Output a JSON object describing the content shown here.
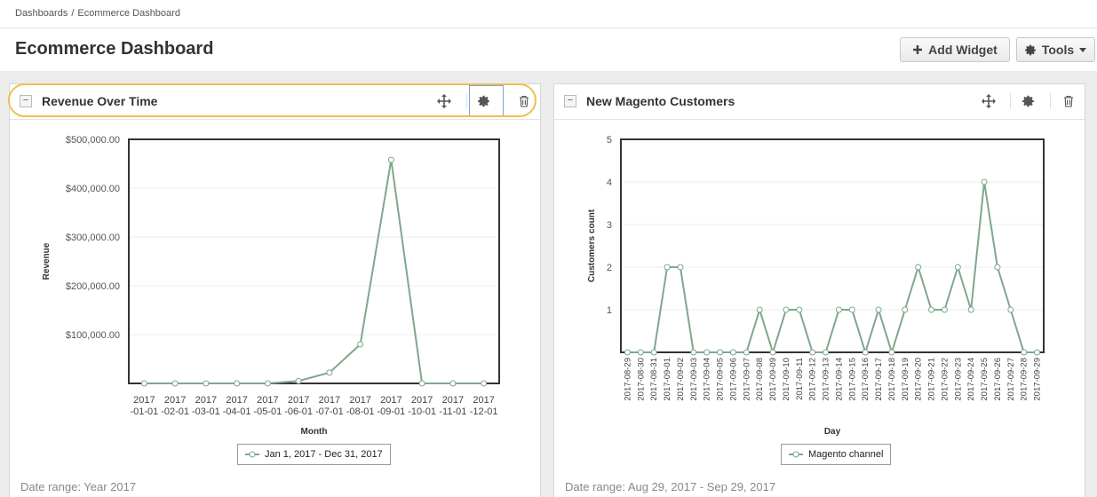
{
  "breadcrumb": {
    "root": "Dashboards",
    "separator": "/",
    "current": "Ecommerce Dashboard"
  },
  "page": {
    "title": "Ecommerce Dashboard"
  },
  "toolbar": {
    "add_widget_label": "Add Widget",
    "tools_label": "Tools"
  },
  "colors": {
    "series": "#7ea88c",
    "highlight": "#f0c050",
    "active_icon_border": "#7aa6d8"
  },
  "widgets": [
    {
      "title": "Revenue Over Time",
      "collapse_label": "−",
      "icons": [
        "move-icon",
        "gear-icon",
        "trash-icon"
      ],
      "footer": "Date range: Year 2017",
      "legend": "Jan 1, 2017 - Dec 31, 2017"
    },
    {
      "title": "New Magento Customers",
      "collapse_label": "−",
      "icons": [
        "move-icon",
        "gear-icon",
        "trash-icon"
      ],
      "footer": "Date range: Aug 29, 2017 - Sep 29, 2017",
      "legend": "Magento channel"
    }
  ],
  "chart_data": [
    {
      "type": "line",
      "xlabel": "Month",
      "ylabel": "Revenue",
      "categories": [
        "2017-01-01",
        "2017-02-01",
        "2017-03-01",
        "2017-04-01",
        "2017-05-01",
        "2017-06-01",
        "2017-07-01",
        "2017-08-01",
        "2017-09-01",
        "2017-10-01",
        "2017-11-01",
        "2017-12-01"
      ],
      "series": [
        {
          "name": "Jan 1, 2017 - Dec 31, 2017",
          "values": [
            0,
            0,
            0,
            0,
            0,
            5000,
            22000,
            80000,
            458000,
            0,
            0,
            0
          ]
        }
      ],
      "ylim": [
        0,
        500000
      ],
      "yticks": [
        100000,
        200000,
        300000,
        400000,
        500000
      ],
      "ytick_labels": [
        "$100,000.00",
        "$200,000.00",
        "$300,000.00",
        "$400,000.00",
        "$500,000.00"
      ],
      "grid": true,
      "legend_position": "bottom"
    },
    {
      "type": "line",
      "xlabel": "Day",
      "ylabel": "Customers count",
      "categories": [
        "2017-08-29",
        "2017-08-30",
        "2017-08-31",
        "2017-09-01",
        "2017-09-02",
        "2017-09-03",
        "2017-09-04",
        "2017-09-05",
        "2017-09-06",
        "2017-09-07",
        "2017-09-08",
        "2017-09-09",
        "2017-09-10",
        "2017-09-11",
        "2017-09-12",
        "2017-09-13",
        "2017-09-14",
        "2017-09-15",
        "2017-09-16",
        "2017-09-17",
        "2017-09-18",
        "2017-09-19",
        "2017-09-20",
        "2017-09-21",
        "2017-09-22",
        "2017-09-23",
        "2017-09-24",
        "2017-09-25",
        "2017-09-26",
        "2017-09-27",
        "2017-09-28",
        "2017-09-29"
      ],
      "series": [
        {
          "name": "Magento channel",
          "values": [
            0,
            0,
            0,
            2,
            2,
            0,
            0,
            0,
            0,
            0,
            1,
            0,
            1,
            1,
            0,
            0,
            1,
            1,
            0,
            1,
            0,
            1,
            2,
            1,
            1,
            2,
            1,
            4,
            2,
            1,
            0,
            0
          ]
        }
      ],
      "ylim": [
        0,
        5
      ],
      "yticks": [
        1,
        2,
        3,
        4,
        5
      ],
      "ytick_labels": [
        "1",
        "2",
        "3",
        "4",
        "5"
      ],
      "grid": true,
      "legend_position": "bottom"
    }
  ]
}
